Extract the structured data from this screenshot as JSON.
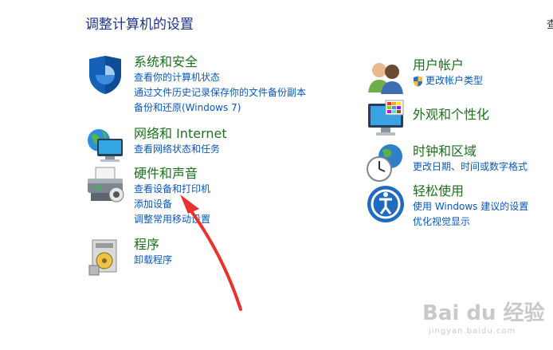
{
  "header": {
    "title": "调整计算机的设置",
    "view_by": "查"
  },
  "categories": {
    "security": {
      "title": "系统和安全",
      "links": [
        "查看你的计算机状态",
        "通过文件历史记录保存你的文件备份副本",
        "备份和还原(Windows 7)"
      ]
    },
    "network": {
      "title": "网络和 Internet",
      "links": [
        "查看网络状态和任务"
      ]
    },
    "hardware": {
      "title": "硬件和声音",
      "links": [
        "查看设备和打印机",
        "添加设备",
        "调整常用移动设置"
      ]
    },
    "programs": {
      "title": "程序",
      "links": [
        "卸载程序"
      ]
    },
    "accounts": {
      "title": "用户帐户",
      "links": [
        "更改帐户类型"
      ]
    },
    "appearance": {
      "title": "外观和个性化",
      "links": []
    },
    "clock": {
      "title": "时钟和区域",
      "links": [
        "更改日期、时间或数字格式"
      ]
    },
    "ease": {
      "title": "轻松使用",
      "links": [
        "使用 Windows 建议的设置",
        "优化视觉显示"
      ]
    }
  },
  "annotation": {
    "arrow_color": "#e8322d"
  },
  "watermark": {
    "brand": "Bai du 经验",
    "url": "jingyan.baidu.com"
  }
}
